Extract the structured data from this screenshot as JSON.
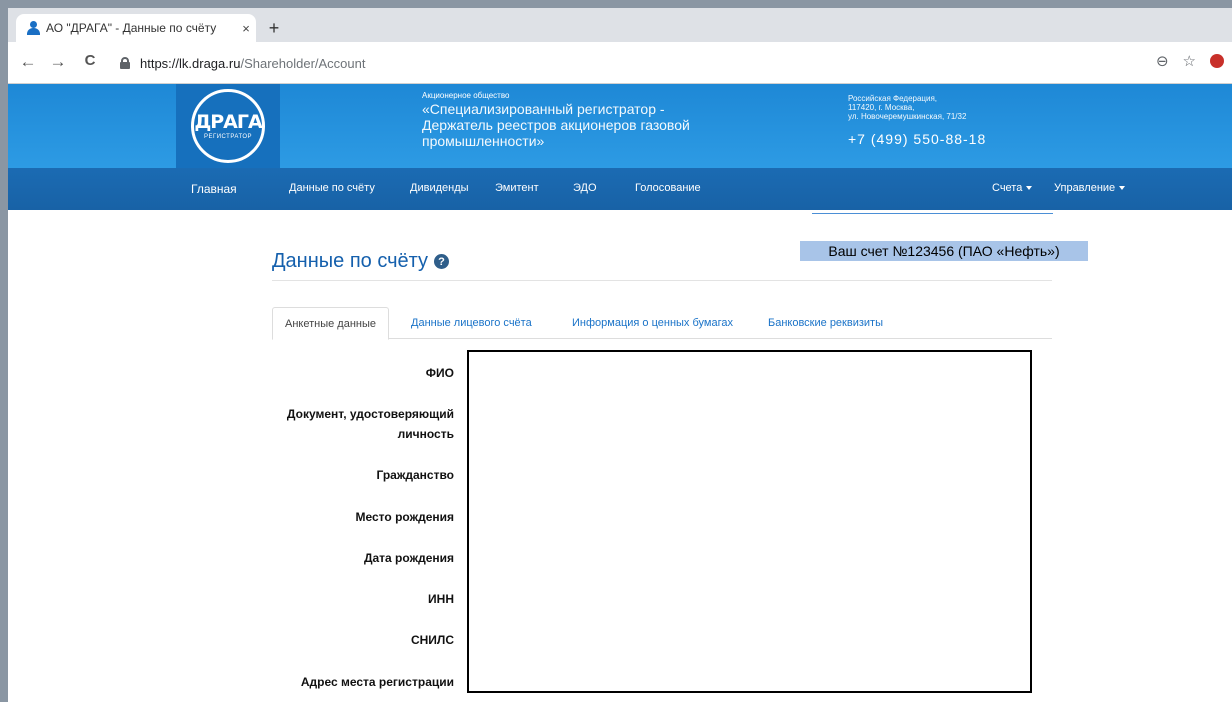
{
  "browser": {
    "tab_title": "АО \"ДРАГА\" - Данные по счёту",
    "tab_close": "×",
    "new_tab": "+",
    "url_host": "https://lk.draga.ru",
    "url_path": "/Shareholder/Account",
    "back": "←",
    "forward": "→",
    "reload": "C",
    "zoom_icon": "⊖",
    "star_icon": "☆"
  },
  "header": {
    "logo_text": "ДРАГА",
    "logo_sub": "РЕГИСТРАТОР",
    "org_small": "Акционерное общество",
    "org_name": "«Специализированный регистратор - Держатель реестров акционеров газовой промышленности»",
    "addr_line1": "Российская Федерация,",
    "addr_line2": "117420, г. Москва,",
    "addr_line3": "ул. Новочеремушкинская, 71/32",
    "phone": "+7 (499) 550-88-18"
  },
  "nav": {
    "items": [
      "Главная",
      "Данные по счёту",
      "Дивиденды",
      "Эмитент",
      "ЭДО",
      "Голосование"
    ],
    "accounts": "Счета",
    "management": "Управление"
  },
  "main": {
    "title": "Данные по счёту",
    "help": "?",
    "account_badge": "Ваш счет №123456 (ПАО «Нефть»)",
    "tabs": [
      "Анкетные данные",
      "Данные лицевого счёта",
      "Информация о ценных бумагах",
      "Банковские реквизиты"
    ],
    "active_tab": "Анкетные данные",
    "fields": {
      "fio": "ФИО",
      "doc_line1": "Документ, удостоверяющий",
      "doc_line2": "личность",
      "citizenship": "Гражданство",
      "birthplace": "Место рождения",
      "birthdate": "Дата рождения",
      "inn": "ИНН",
      "snils": "СНИЛС",
      "address": "Адрес места регистрации"
    }
  }
}
